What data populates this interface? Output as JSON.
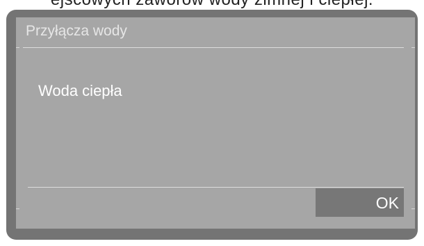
{
  "header": {
    "cut_caption": "ejscowych zaworów wody zimnej i ciepłej."
  },
  "dialog": {
    "title": "Przyłącza wody",
    "message": "Woda ciepła",
    "ok_label": "OK"
  }
}
